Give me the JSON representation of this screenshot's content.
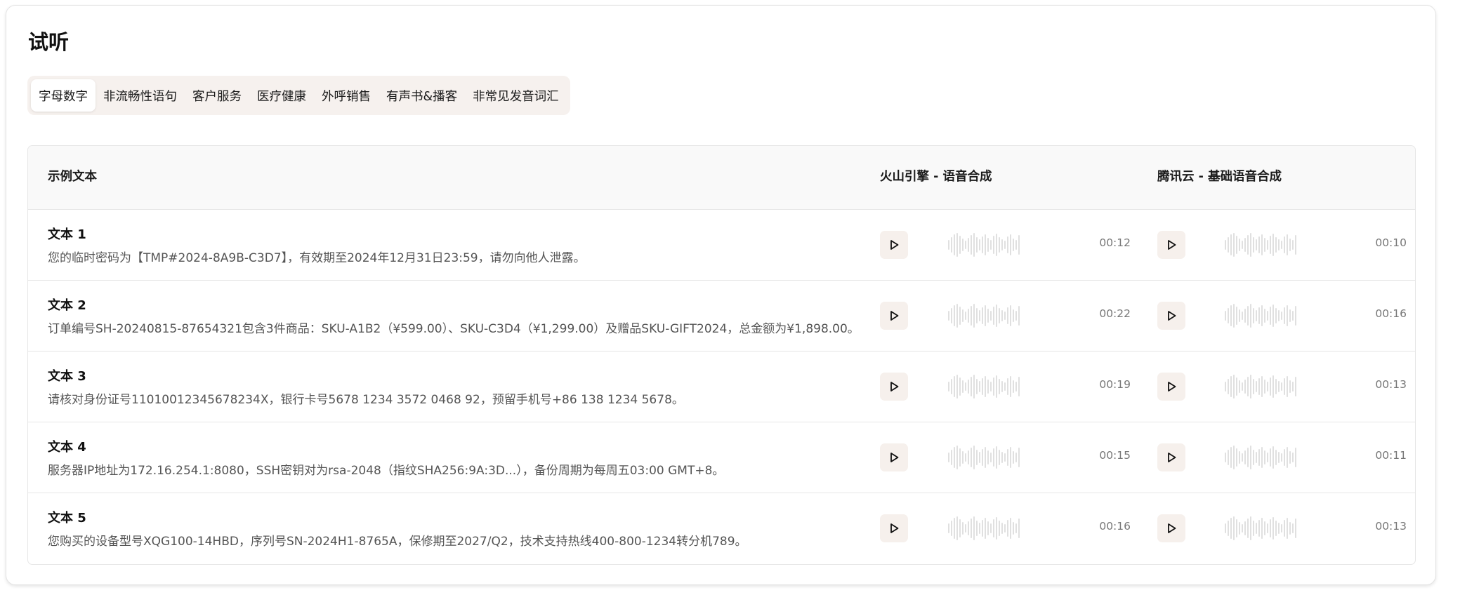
{
  "page": {
    "title": "试听"
  },
  "tabs": [
    {
      "label": "字母数字",
      "active": true
    },
    {
      "label": "非流畅性语句",
      "active": false
    },
    {
      "label": "客户服务",
      "active": false
    },
    {
      "label": "医疗健康",
      "active": false
    },
    {
      "label": "外呼销售",
      "active": false
    },
    {
      "label": "有声书&播客",
      "active": false
    },
    {
      "label": "非常见发音词汇",
      "active": false
    }
  ],
  "table": {
    "headers": {
      "sample": "示例文本",
      "engine_a": "火山引擎 - 语音合成",
      "engine_b": "腾讯云 - 基础语音合成"
    },
    "rows": [
      {
        "name": "文本 1",
        "text": "您的临时密码为【TMP#2024-8A9B-C3D7】，有效期至2024年12月31日23:59，请勿向他人泄露。",
        "duration_a": "00:12",
        "duration_b": "00:10"
      },
      {
        "name": "文本 2",
        "text": "订单编号SH-20240815-87654321包含3件商品：SKU-A1B2（¥599.00）、SKU-C3D4（¥1,299.00）及赠品SKU-GIFT2024，总金额为¥1,898.00。",
        "duration_a": "00:22",
        "duration_b": "00:16"
      },
      {
        "name": "文本 3",
        "text": "请核对身份证号11010012345678234X，银行卡号5678 1234 3572 0468 92，预留手机号+86 138 1234 5678。",
        "duration_a": "00:19",
        "duration_b": "00:13"
      },
      {
        "name": "文本 4",
        "text": "服务器IP地址为172.16.254.1:8080，SSH密钥对为rsa-2048（指纹SHA256:9A:3D...），备份周期为每周五03:00 GMT+8。",
        "duration_a": "00:15",
        "duration_b": "00:11"
      },
      {
        "name": "文本 5",
        "text": "您购买的设备型号XQG100-14HBD，序列号SN-2024H1-8765A，保修期至2027/Q2，技术支持热线400-800-1234转分机789。",
        "duration_a": "00:16",
        "duration_b": "00:13"
      }
    ]
  },
  "icons": {
    "play": "play-icon",
    "waveform": "waveform-icon"
  },
  "colors": {
    "tab_bar_bg": "#f6f1ee",
    "play_button_bg": "#f6f0ec",
    "waveform": "#e0e0e0",
    "header_bg": "#f9f9f9"
  }
}
